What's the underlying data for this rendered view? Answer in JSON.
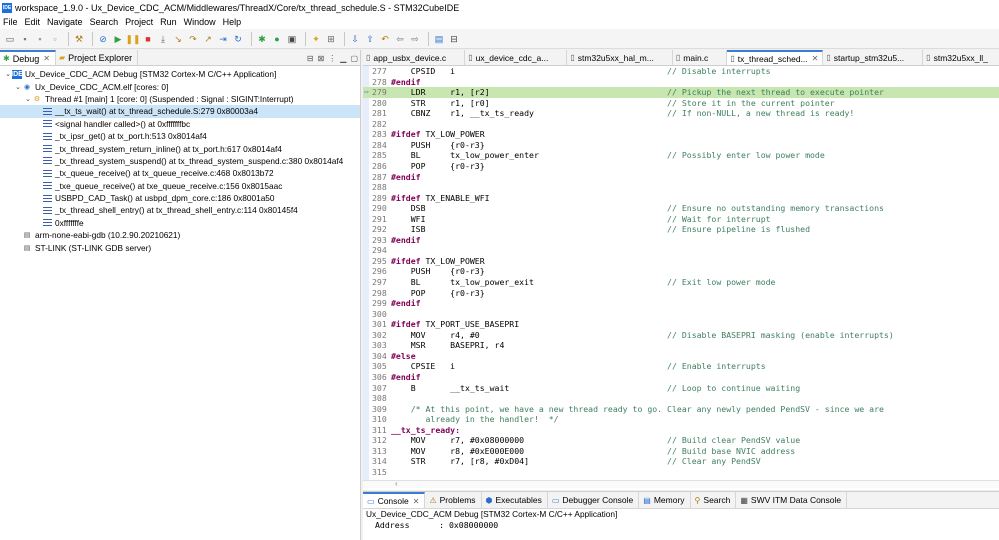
{
  "window": {
    "title": "workspace_1.9.0 - Ux_Device_CDC_ACM/Middlewares/ThreadX/Core/tx_thread_schedule.S - STM32CubeIDE",
    "app_icon_text": "IDE"
  },
  "menu": [
    "File",
    "Edit",
    "Navigate",
    "Search",
    "Project",
    "Run",
    "Window",
    "Help"
  ],
  "left_tabs": [
    {
      "label": "Debug",
      "icon": "bug-icon"
    },
    {
      "label": "Project Explorer",
      "icon": "folder-icon"
    }
  ],
  "tree": [
    {
      "indent": 0,
      "arrow": "v",
      "icon": "ide",
      "label": "Ux_Device_CDC_ACM Debug [STM32 Cortex-M C/C++ Application]"
    },
    {
      "indent": 1,
      "arrow": "v",
      "icon": "elf",
      "label": "Ux_Device_CDC_ACM.elf [cores: 0]"
    },
    {
      "indent": 2,
      "arrow": "v",
      "icon": "thread",
      "label": "Thread #1 [main] 1 [core: 0] (Suspended : Signal : SIGINT:Interrupt)"
    },
    {
      "indent": 3,
      "arrow": "",
      "icon": "frame",
      "label": "__tx_ts_wait() at tx_thread_schedule.S:279 0x80003a4",
      "selected": true
    },
    {
      "indent": 3,
      "arrow": "",
      "icon": "frame",
      "label": "<signal handler called>() at 0xfffffffbc"
    },
    {
      "indent": 3,
      "arrow": "",
      "icon": "frame",
      "label": "_tx_ipsr_get() at tx_port.h:513 0x8014af4"
    },
    {
      "indent": 3,
      "arrow": "",
      "icon": "frame",
      "label": "_tx_thread_system_return_inline() at tx_port.h:617 0x8014af4"
    },
    {
      "indent": 3,
      "arrow": "",
      "icon": "frame",
      "label": "_tx_thread_system_suspend() at tx_thread_system_suspend.c:380 0x8014af4"
    },
    {
      "indent": 3,
      "arrow": "",
      "icon": "frame",
      "label": "_tx_queue_receive() at tx_queue_receive.c:468 0x8013b72"
    },
    {
      "indent": 3,
      "arrow": "",
      "icon": "frame",
      "label": "_txe_queue_receive() at txe_queue_receive.c:156 0x8015aac"
    },
    {
      "indent": 3,
      "arrow": "",
      "icon": "frame",
      "label": "USBPD_CAD_Task() at usbpd_dpm_core.c:186 0x8001a50"
    },
    {
      "indent": 3,
      "arrow": "",
      "icon": "frame",
      "label": "_tx_thread_shell_entry() at tx_thread_shell_entry.c:114 0x80145f4"
    },
    {
      "indent": 3,
      "arrow": "",
      "icon": "frame",
      "label": "0xfffffffe"
    },
    {
      "indent": 1,
      "arrow": "",
      "icon": "gdb",
      "label": "arm-none-eabi-gdb (10.2.90.20210621)"
    },
    {
      "indent": 1,
      "arrow": "",
      "icon": "gdb",
      "label": "ST-LINK (ST-LINK GDB server)"
    }
  ],
  "editor_tabs": [
    {
      "label": "app_usbx_device.c",
      "active": false
    },
    {
      "label": "ux_device_cdc_a...",
      "active": false
    },
    {
      "label": "stm32u5xx_hal_m...",
      "active": false
    },
    {
      "label": "main.c",
      "active": false
    },
    {
      "label": "tx_thread_sched...",
      "active": true
    },
    {
      "label": "startup_stm32u5...",
      "active": false
    },
    {
      "label": "stm32u5xx_ll_",
      "active": false
    }
  ],
  "code": [
    {
      "n": "277",
      "t": "    CPSID   i                                           // Disable interrupts"
    },
    {
      "n": "278",
      "t": "#endif"
    },
    {
      "n": "279",
      "t": "    LDR     r1, [r2]                                    // Pickup the next thread to execute pointer",
      "current": true
    },
    {
      "n": "280",
      "t": "    STR     r1, [r0]                                    // Store it in the current pointer"
    },
    {
      "n": "281",
      "t": "    CBNZ    r1, __tx_ts_ready                           // If non-NULL, a new thread is ready!"
    },
    {
      "n": "282",
      "t": ""
    },
    {
      "n": "283",
      "t": "#ifdef TX_LOW_POWER"
    },
    {
      "n": "284",
      "t": "    PUSH    {r0-r3}"
    },
    {
      "n": "285",
      "t": "    BL      tx_low_power_enter                          // Possibly enter low power mode"
    },
    {
      "n": "286",
      "t": "    POP     {r0-r3}"
    },
    {
      "n": "287",
      "t": "#endif"
    },
    {
      "n": "288",
      "t": ""
    },
    {
      "n": "289",
      "t": "#ifdef TX_ENABLE_WFI"
    },
    {
      "n": "290",
      "t": "    DSB                                                 // Ensure no outstanding memory transactions"
    },
    {
      "n": "291",
      "t": "    WFI                                                 // Wait for interrupt"
    },
    {
      "n": "292",
      "t": "    ISB                                                 // Ensure pipeline is flushed"
    },
    {
      "n": "293",
      "t": "#endif"
    },
    {
      "n": "294",
      "t": ""
    },
    {
      "n": "295",
      "t": "#ifdef TX_LOW_POWER"
    },
    {
      "n": "296",
      "t": "    PUSH    {r0-r3}"
    },
    {
      "n": "297",
      "t": "    BL      tx_low_power_exit                           // Exit low power mode"
    },
    {
      "n": "298",
      "t": "    POP     {r0-r3}"
    },
    {
      "n": "299",
      "t": "#endif"
    },
    {
      "n": "300",
      "t": ""
    },
    {
      "n": "301",
      "t": "#ifdef TX_PORT_USE_BASEPRI"
    },
    {
      "n": "302",
      "t": "    MOV     r4, #0                                      // Disable BASEPRI masking (enable interrupts)"
    },
    {
      "n": "303",
      "t": "    MSR     BASEPRI, r4"
    },
    {
      "n": "304",
      "t": "#else"
    },
    {
      "n": "305",
      "t": "    CPSIE   i                                           // Enable interrupts"
    },
    {
      "n": "306",
      "t": "#endif"
    },
    {
      "n": "307",
      "t": "    B       __tx_ts_wait                                // Loop to continue waiting"
    },
    {
      "n": "308",
      "t": ""
    },
    {
      "n": "309",
      "t": "    /* At this point, we have a new thread ready to go. Clear any newly pended PendSV - since we are"
    },
    {
      "n": "310",
      "t": "       already in the handler!  */"
    },
    {
      "n": "311",
      "t": "__tx_ts_ready:"
    },
    {
      "n": "312",
      "t": "    MOV     r7, #0x08000000                             // Build clear PendSV value"
    },
    {
      "n": "313",
      "t": "    MOV     r8, #0xE000E000                             // Build base NVIC address"
    },
    {
      "n": "314",
      "t": "    STR     r7, [r8, #0xD04]                            // Clear any PendSV"
    },
    {
      "n": "315",
      "t": ""
    }
  ],
  "bottom_tabs": [
    {
      "label": "Console",
      "icon": "console-icon",
      "active": true
    },
    {
      "label": "Problems",
      "icon": "problems-icon",
      "active": false
    },
    {
      "label": "Executables",
      "icon": "executables-icon",
      "active": false
    },
    {
      "label": "Debugger Console",
      "icon": "debugger-console-icon",
      "active": false
    },
    {
      "label": "Memory",
      "icon": "memory-icon",
      "active": false
    },
    {
      "label": "Search",
      "icon": "search-icon",
      "active": false
    },
    {
      "label": "SWV ITM Data Console",
      "icon": "swv-icon",
      "active": false
    }
  ],
  "console": {
    "title": "Ux_Device_CDC_ACM Debug [STM32 Cortex-M C/C++ Application]",
    "lines": [
      "Address      : 0x08000000"
    ]
  }
}
